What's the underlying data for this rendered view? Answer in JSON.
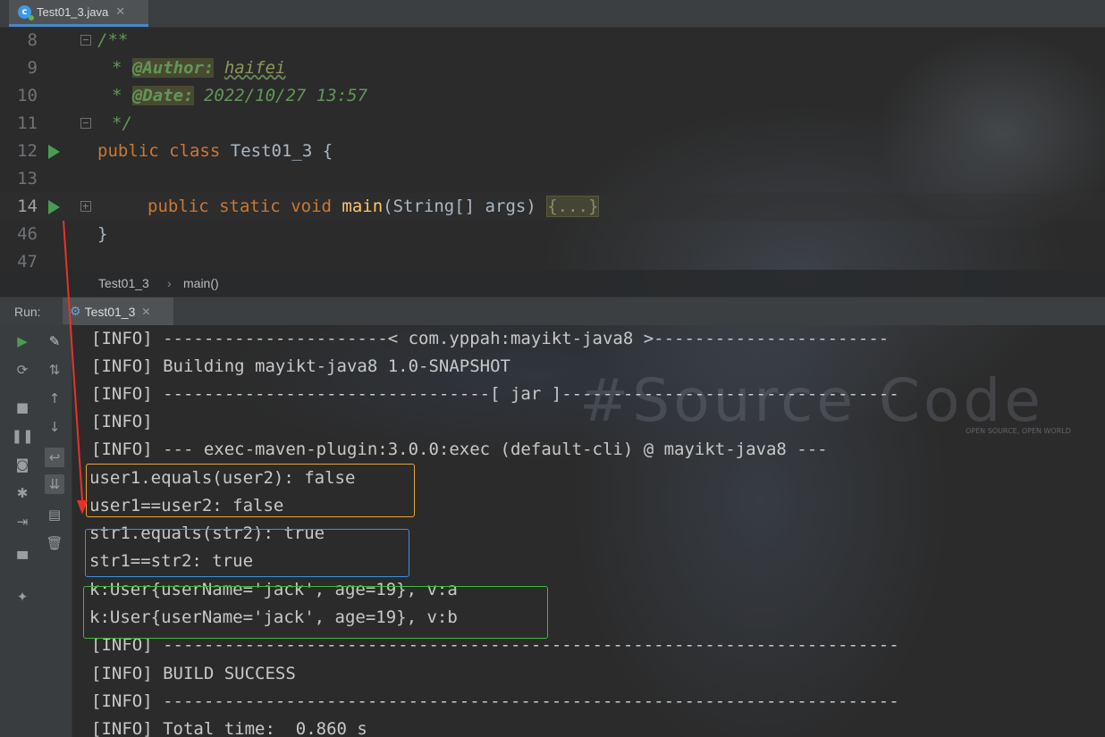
{
  "file_tab": {
    "title": "Test01_3.java",
    "close": "✕",
    "icon": "c"
  },
  "editor_lines": [
    {
      "num": "8",
      "text": "/**"
    },
    {
      "num": "9",
      "star": "* ",
      "tag": "@Author:",
      "val": "haifei"
    },
    {
      "num": "10",
      "star": "* ",
      "tag": "@Date:",
      "val": "2022/10/27 13:57"
    },
    {
      "num": "11",
      "text": "*/"
    },
    {
      "num": "12",
      "kw1": "public",
      "kw2": "class",
      "rest": "Test01_3 {"
    },
    {
      "num": "13",
      "text": ""
    },
    {
      "num": "14",
      "kw1": "public",
      "kw2": "static",
      "kw3": "void",
      "fn": "main",
      "rest": "(String[] args)",
      "fold": "{...}"
    },
    {
      "num": "46",
      "text": "}"
    },
    {
      "num": "47",
      "text": ""
    }
  ],
  "breadcrumb": {
    "class": "Test01_3",
    "sep": "›",
    "method": "main()"
  },
  "run_panel": {
    "label": "Run:",
    "tab_title": "Test01_3",
    "tab_close": "✕"
  },
  "console_lines": [
    "[INFO] ----------------------< com.yppah:mayikt-java8 >-----------------------",
    "[INFO] Building mayikt-java8 1.0-SNAPSHOT",
    "[INFO] --------------------------------[ jar ]---------------------------------",
    "[INFO]",
    "[INFO] --- exec-maven-plugin:3.0.0:exec (default-cli) @ mayikt-java8 ---",
    "user1.equals(user2): false",
    "user1==user2: false",
    "str1.equals(str2): true",
    "str1==str2: true",
    "k:User{userName='jack', age=19}, v:a",
    "k:User{userName='jack', age=19}, v:b",
    "[INFO] ------------------------------------------------------------------------",
    "[INFO] BUILD SUCCESS",
    "[INFO] ------------------------------------------------------------------------",
    "[INFO] Total time:  0.860 s"
  ],
  "background_art": {
    "word": "#Source Code",
    "small": "OPEN SOURCE, OPEN WORLD"
  },
  "colors": {
    "keyword": "#cc7832",
    "comment": "#629755",
    "method": "#ffc66d",
    "highlight_yellow": "#e8a33a",
    "highlight_blue": "#3d8fe0",
    "highlight_green": "#3db83d",
    "annotation_red": "#e8322b"
  }
}
